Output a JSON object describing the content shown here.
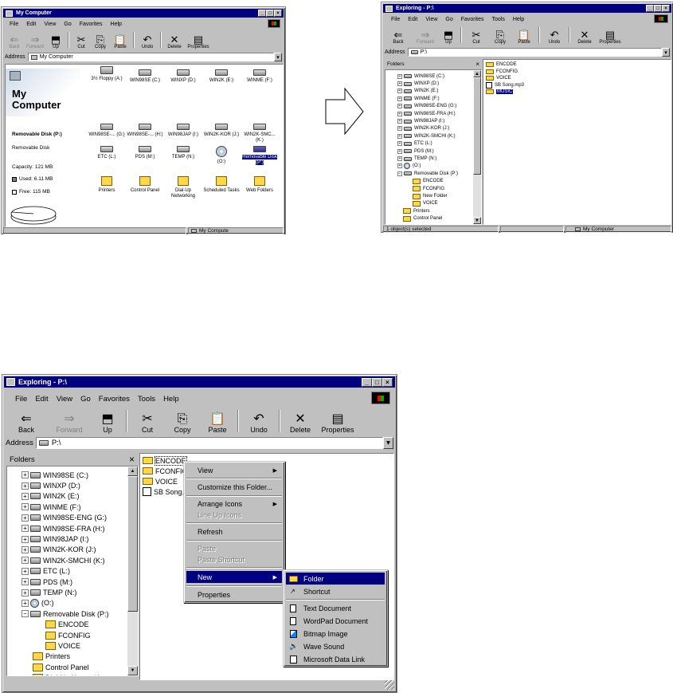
{
  "window_a": {
    "title": "My Computer",
    "menu": [
      "File",
      "Edit",
      "View",
      "Go",
      "Favorites",
      "Help"
    ],
    "toolbar": [
      "Back",
      "Forward",
      "Up",
      "Cut",
      "Copy",
      "Paste",
      "Undo",
      "Delete",
      "Properties"
    ],
    "address_label": "Address",
    "address_value": "My Computer",
    "info": {
      "heading_line1": "My",
      "heading_line2": "Computer",
      "disk_name": "Removable Disk (P:)",
      "disk_type": "Removable Disk",
      "capacity": "Capacity: 121 MB",
      "used": "Used: 6.11 MB",
      "free": "Free: 115 MB"
    },
    "icons": [
      "3½ Floppy (A:)",
      "WIN98SE (C:)",
      "WINXP (D:)",
      "WIN2K (E:)",
      "WINME (F:)",
      "WIN98SE-... (G:)",
      "WIN98SE-... (H:)",
      "WIN98JAP (I:)",
      "WIN2K-KOR (J:)",
      "WIN2K-SMC... (K:)",
      "ETC (L:)",
      "PDS (M:)",
      "TEMP (N:)",
      "(O:)",
      "Removable Disk (P:)",
      "Printers",
      "Control Panel",
      "Dial-Up Networking",
      "Scheduled Tasks",
      "Web Folders"
    ],
    "status": "My Compute"
  },
  "window_b": {
    "title": "Exploring - P:\\",
    "menu": [
      "File",
      "Edit",
      "View",
      "Go",
      "Favorites",
      "Tools",
      "Help"
    ],
    "toolbar": [
      "Back",
      "Forward",
      "Up",
      "Cut",
      "Copy",
      "Paste",
      "Undo",
      "Delete",
      "Properties"
    ],
    "address_label": "Address",
    "address_value": "P:\\",
    "folders_label": "Folders",
    "tree": [
      "WIN98SE (C:)",
      "WINXP (D:)",
      "WIN2K (E:)",
      "WINME (F:)",
      "WIN98SE-ENG (G:)",
      "WIN98SE-FRA (H:)",
      "WIN98JAP (I:)",
      "WIN2K-KOR (J:)",
      "WIN2K-SMCHI (K:)",
      "ETC (L:)",
      "PDS (M:)",
      "TEMP (N:)",
      "(O:)",
      "Removable Disk (P:)",
      "ENCODE",
      "FCONFIG",
      "New Folder",
      "VOICE",
      "Printers",
      "Control Panel"
    ],
    "files": [
      "ENCODE",
      "FCONFIG",
      "VOICE",
      "SB Song.mp3",
      "MUSIC"
    ],
    "status_left": "1 object(s) selected",
    "status_right": "My Computer"
  },
  "window_c": {
    "title": "Exploring - P:\\",
    "menu": [
      "File",
      "Edit",
      "View",
      "Go",
      "Favorites",
      "Tools",
      "Help"
    ],
    "toolbar": [
      "Back",
      "Forward",
      "Up",
      "Cut",
      "Copy",
      "Paste",
      "Undo",
      "Delete",
      "Properties"
    ],
    "address_label": "Address",
    "address_value": "P:\\",
    "folders_label": "Folders",
    "tree": [
      "WIN98SE (C:)",
      "WINXP (D:)",
      "WIN2K (E:)",
      "WINME (F:)",
      "WIN98SE-ENG (G:)",
      "WIN98SE-FRA (H:)",
      "WIN98JAP (I:)",
      "WIN2K-KOR (J:)",
      "WIN2K-SMCHI (K:)",
      "ETC (L:)",
      "PDS (M:)",
      "TEMP (N:)",
      "(O:)",
      "Removable Disk (P:)",
      "ENCODE",
      "FCONFIG",
      "VOICE",
      "Printers",
      "Control Panel",
      "Dial-Up Networking"
    ],
    "files": [
      "ENCODE",
      "FCONFIG",
      "VOICE",
      "SB Song.m"
    ],
    "context_menu": [
      "View",
      "Customize this Folder...",
      "Arrange Icons",
      "Line Up Icons",
      "Refresh",
      "Paste",
      "Paste Shortcut",
      "New",
      "Properties"
    ],
    "new_submenu": [
      "Folder",
      "Shortcut",
      "Text Document",
      "WordPad Document",
      "Bitmap Image",
      "Wave Sound",
      "Microsoft Data Link"
    ]
  }
}
